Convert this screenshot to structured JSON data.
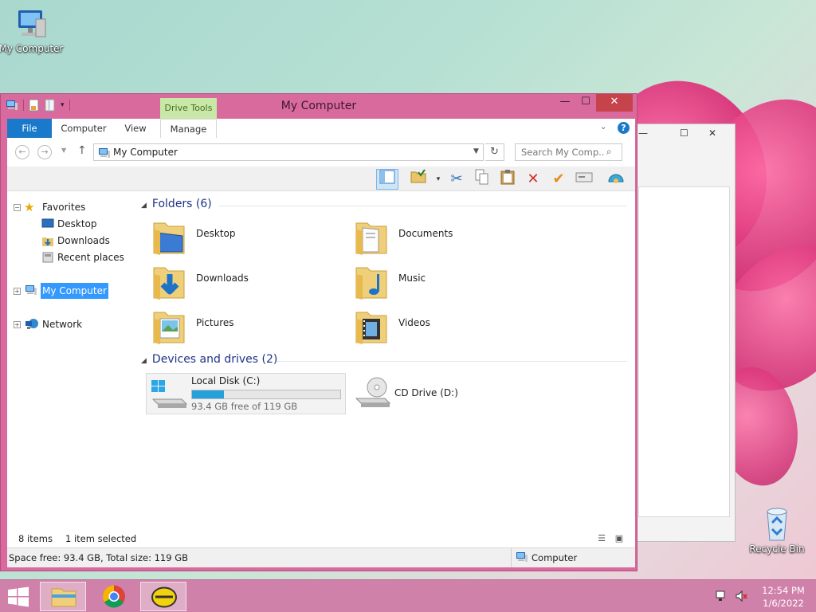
{
  "desktop": {
    "icons": [
      {
        "label": "My Computer",
        "icon": "computer-icon"
      },
      {
        "label": "Recycle Bin",
        "icon": "recycle-bin-icon"
      }
    ]
  },
  "window": {
    "title": "My Computer",
    "context_tab_header": "Drive Tools",
    "controls": {
      "minimize": "—",
      "maximize": "☐",
      "close": "✕"
    },
    "ribbon_tabs": [
      "File",
      "Computer",
      "View",
      "Manage"
    ],
    "help": "?",
    "address": "My Computer",
    "search_placeholder": "Search My Comp...",
    "tree": {
      "favorites": "Favorites",
      "favorites_items": [
        "Desktop",
        "Downloads",
        "Recent places"
      ],
      "my_computer": "My Computer",
      "network": "Network"
    },
    "groups": {
      "folders_header": "Folders (6)",
      "folders": [
        {
          "label": "Desktop",
          "icon": "desktop-folder-icon"
        },
        {
          "label": "Documents",
          "icon": "documents-folder-icon"
        },
        {
          "label": "Downloads",
          "icon": "downloads-folder-icon"
        },
        {
          "label": "Music",
          "icon": "music-folder-icon"
        },
        {
          "label": "Pictures",
          "icon": "pictures-folder-icon"
        },
        {
          "label": "Videos",
          "icon": "videos-folder-icon"
        }
      ],
      "drives_header": "Devices and drives (2)",
      "drives": [
        {
          "label": "Local Disk (C:)",
          "free_text": "93.4 GB free of 119 GB",
          "used_fraction": 0.215
        },
        {
          "label": "CD Drive (D:)"
        }
      ]
    },
    "status": {
      "items": "8 items",
      "selected": "1 item selected",
      "details": "Space free: 93.4 GB, Total size: 119 GB",
      "location": "Computer"
    }
  },
  "taskbar": {
    "time": "12:54 PM",
    "date": "1/6/2022",
    "colors": {
      "accent": "#1979ca",
      "window_frame": "#d96a9e",
      "selection": "#3399ff"
    }
  }
}
